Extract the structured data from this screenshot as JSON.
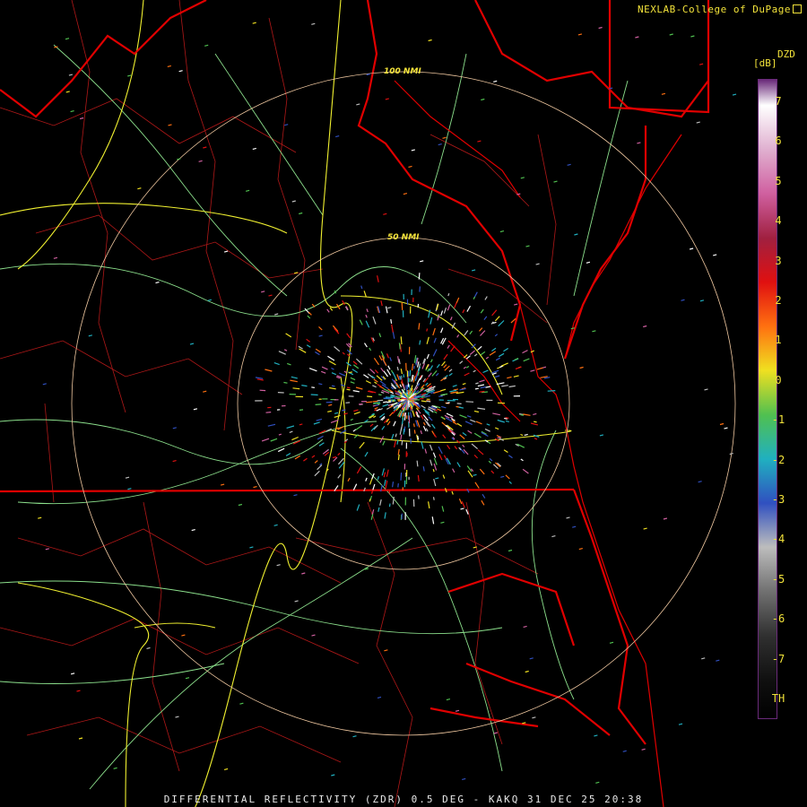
{
  "credit": "NEXLAB-College of DuPage",
  "footer": "DIFFERENTIAL REFLECTIVITY (ZDR) 0.5 DEG - KAKQ 31 DEC 25 20:38",
  "colorbar": {
    "product": "DZD",
    "unit": "[dB]",
    "ticks": [
      "7",
      "6",
      "5",
      "4",
      "3",
      "2",
      "1",
      "0",
      "-1",
      "-2",
      "-3",
      "-4",
      "-5",
      "-6",
      "-7",
      "TH"
    ],
    "stops": [
      "#ffffff",
      "#e0b0d0",
      "#d060a0",
      "#a02040",
      "#e01010",
      "#ff7010",
      "#f0e020",
      "#50c050",
      "#20b0c0",
      "#3050c0",
      "#bdbdbd",
      "#707070",
      "#303030",
      "#101010"
    ]
  },
  "range_rings": [
    {
      "label": "50 NMI"
    },
    {
      "label": "100 NMI"
    }
  ],
  "colors": {
    "state_border": "#e00000",
    "county_border": "#b01818",
    "interstate": "#f0f030",
    "highway": "#8ce08c",
    "range_ring": "#f0c8a0"
  }
}
